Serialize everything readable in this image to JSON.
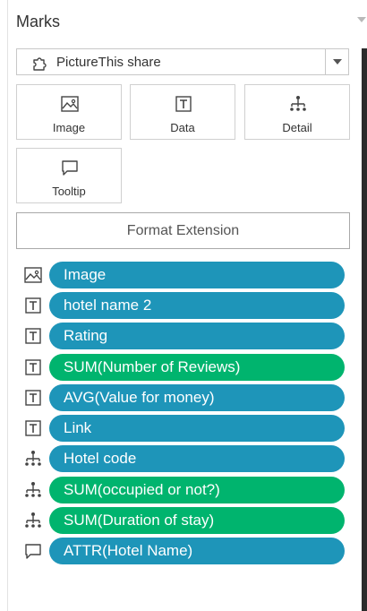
{
  "panel": {
    "title": "Marks"
  },
  "mark_type": {
    "label": "PictureThis share",
    "icon": "puzzle-extension-icon"
  },
  "cards": [
    {
      "label": "Image",
      "icon": "image-icon"
    },
    {
      "label": "Data",
      "icon": "text-icon"
    },
    {
      "label": "Detail",
      "icon": "detail-icon"
    },
    {
      "label": "Tooltip",
      "icon": "tooltip-icon"
    }
  ],
  "format_button": {
    "label": "Format Extension"
  },
  "fields": [
    {
      "icon": "image-icon",
      "label": "Image",
      "color": "#1e95b9"
    },
    {
      "icon": "text-icon",
      "label": "hotel name 2",
      "color": "#1e95b9"
    },
    {
      "icon": "text-icon",
      "label": "Rating",
      "color": "#1e95b9"
    },
    {
      "icon": "text-icon",
      "label": "SUM(Number of Reviews)",
      "color": "#00b46e"
    },
    {
      "icon": "text-icon",
      "label": "AVG(Value for money)",
      "color": "#1e95b9"
    },
    {
      "icon": "text-icon",
      "label": "Link",
      "color": "#1e95b9"
    },
    {
      "icon": "detail-icon",
      "label": "Hotel code",
      "color": "#1e95b9"
    },
    {
      "icon": "detail-icon",
      "label": "SUM(occupied or not?)",
      "color": "#00b46e"
    },
    {
      "icon": "detail-icon",
      "label": "SUM(Duration of stay)",
      "color": "#00b46e"
    },
    {
      "icon": "tooltip-icon",
      "label": "ATTR(Hotel Name)",
      "color": "#1e95b9"
    }
  ]
}
